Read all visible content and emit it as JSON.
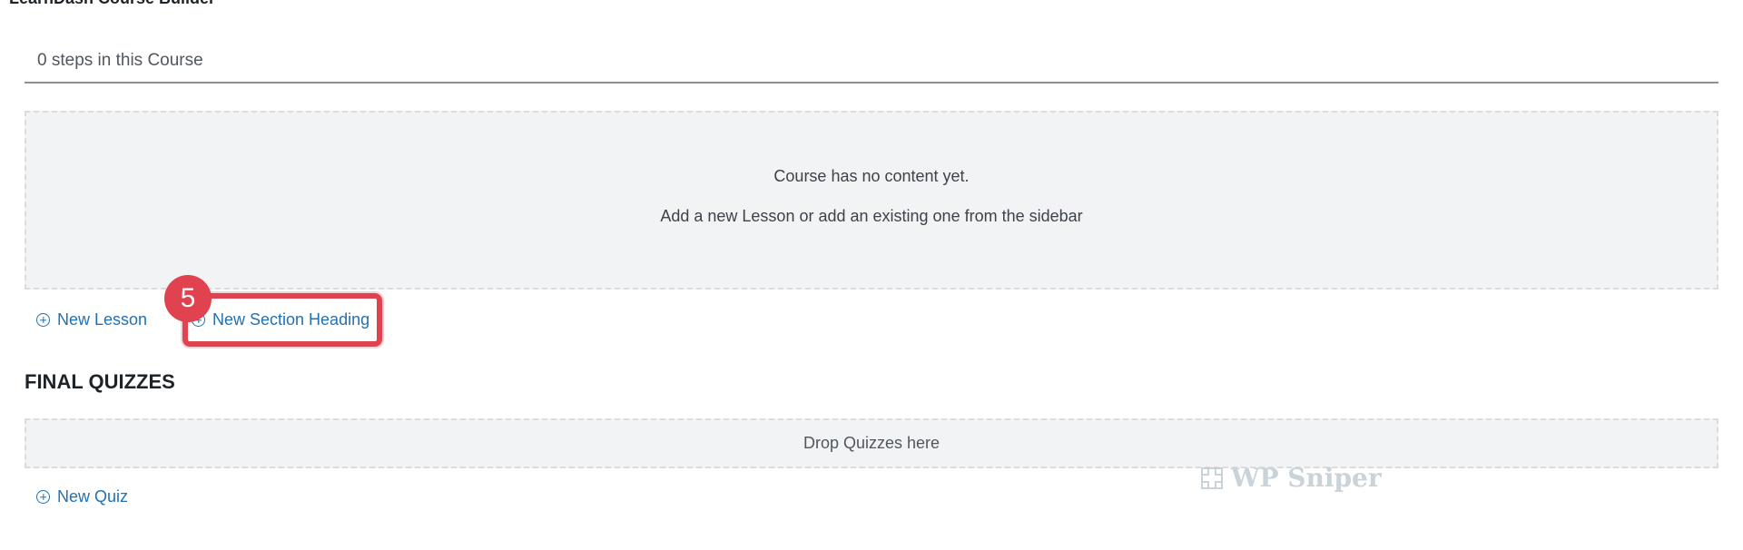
{
  "builder": {
    "title": "LearnDash Course Builder",
    "steps_label": "0 steps in this Course"
  },
  "empty_state": {
    "line1": "Course has no content yet.",
    "line2": "Add a new Lesson or add an existing one from the sidebar"
  },
  "actions": {
    "new_lesson": "New Lesson",
    "new_section_heading": "New Section Heading",
    "new_quiz": "New Quiz"
  },
  "callout": {
    "step_number": "5"
  },
  "final_quizzes": {
    "heading": "FINAL QUIZZES",
    "drop_label": "Drop Quizzes here"
  },
  "watermark": {
    "text": "WP Sniper"
  },
  "icons": {
    "add": "plus-circle-icon"
  },
  "colors": {
    "link": "#2271b1",
    "highlight": "#e0434f",
    "dropzone_bg": "#f2f3f4"
  }
}
